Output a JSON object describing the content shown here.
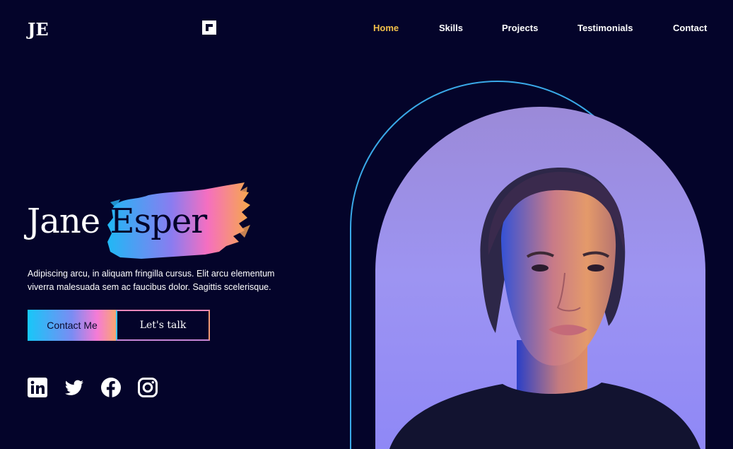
{
  "header": {
    "logo": "JE",
    "nav": [
      {
        "label": "Home",
        "active": true
      },
      {
        "label": "Skills",
        "active": false
      },
      {
        "label": "Projects",
        "active": false
      },
      {
        "label": "Testimonials",
        "active": false
      },
      {
        "label": "Contact",
        "active": false
      }
    ]
  },
  "hero": {
    "first_name": "Jane",
    "last_name": "Esper",
    "description": "Adipiscing arcu, in aliquam fringilla cursus. Elit arcu elementum viverra malesuada sem ac faucibus dolor. Sagittis scelerisque.",
    "primary_button": "Contact Me",
    "secondary_button": "Let's talk"
  },
  "socials": [
    {
      "icon": "linkedin-icon"
    },
    {
      "icon": "twitter-icon"
    },
    {
      "icon": "facebook-icon"
    },
    {
      "icon": "instagram-icon"
    }
  ],
  "colors": {
    "background": "#04042a",
    "accent_active": "#f2c04a",
    "arch_outline": "#3aa9e8",
    "portrait_bg": "#9b8ff0"
  }
}
